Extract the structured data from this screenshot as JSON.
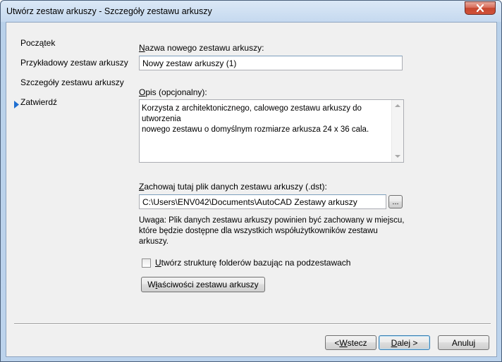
{
  "window": {
    "title": "Utwórz zestaw arkuszy - Szczegóły zestawu arkuszy"
  },
  "nav": {
    "items": [
      {
        "label": "Początek"
      },
      {
        "label": "Przykładowy zestaw arkuszy"
      },
      {
        "label": "Szczegóły zestawu arkuszy"
      },
      {
        "label": "Zatwierdź"
      }
    ],
    "current_index": 2
  },
  "form": {
    "name_label_first": "N",
    "name_label_rest": "azwa nowego zestawu arkuszy:",
    "name_value": "Nowy zestaw arkuszy (1)",
    "desc_label_first": "O",
    "desc_label_rest": "pis (opcjonalny):",
    "desc_line1": "Korzysta z architektonicznego, calowego zestawu arkuszy do utworzenia",
    "desc_line2": "nowego zestawu o domyślnym rozmiarze arkusza 24 x 36 cala.",
    "path_label_first": "Z",
    "path_label_rest": "achowaj tutaj plik danych zestawu arkuszy (.dst):",
    "path_value": "C:\\Users\\ENV042\\Documents\\AutoCAD Zestawy arkuszy",
    "browse_label": "...",
    "note_line1": "Uwaga: Plik danych zestawu arkuszy powinien być zachowany w miejscu,",
    "note_line2": "które będzie dostępne dla wszystkich współużytkowników zestawu arkuszy.",
    "checkbox_label_first": "U",
    "checkbox_label_rest": "twórz strukturę folderów bazując na podzestawach",
    "checkbox_checked": false,
    "properties_label_pre": "W",
    "properties_label_u": "ł",
    "properties_label_post": "aściwości zestawu arkuszy"
  },
  "footer": {
    "back_pre": "< ",
    "back_u": "W",
    "back_post": "stecz",
    "next_u": "D",
    "next_post": "alej >",
    "cancel_label": "Anuluj"
  },
  "colors": {
    "accent_arrow": "#1f6fd1",
    "close_button": "#c7472f"
  }
}
